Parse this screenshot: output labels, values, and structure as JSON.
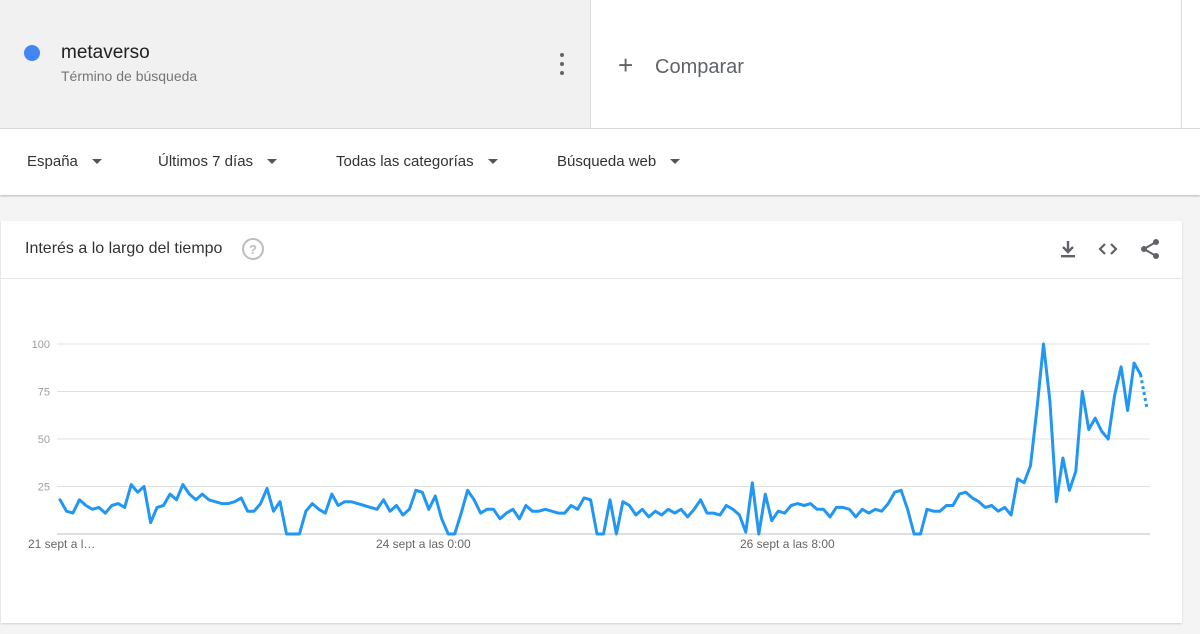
{
  "term": {
    "name": "metaverso",
    "subtitle": "Término de búsqueda",
    "color": "#4285f4"
  },
  "compare": {
    "label": "Comparar"
  },
  "filters": [
    {
      "label": "España"
    },
    {
      "label": "Últimos 7 días"
    },
    {
      "label": "Todas las categorías"
    },
    {
      "label": "Búsqueda web"
    }
  ],
  "chart_header": {
    "title": "Interés a lo largo del tiempo"
  },
  "chart_data": {
    "type": "line",
    "title": "Interés a lo largo del tiempo",
    "xlabel": "",
    "ylabel": "",
    "ylim": [
      0,
      100
    ],
    "y_ticks": [
      "25",
      "50",
      "75",
      "100"
    ],
    "x_ticks": [
      "21 sept a l…",
      "24 sept a las 0:00",
      "26 sept a las 8:00"
    ],
    "grid": true,
    "color": "#2196f3",
    "series": [
      {
        "values": [
          18,
          12,
          11,
          18,
          15,
          13,
          14,
          11,
          15,
          16,
          14,
          26,
          22,
          25,
          6,
          14,
          15,
          21,
          18,
          26,
          21,
          18,
          21,
          18,
          17,
          16,
          16,
          17,
          19,
          12,
          12,
          16,
          24,
          12,
          17,
          0,
          0,
          0,
          12,
          16,
          13,
          11,
          21,
          15,
          17,
          17,
          16,
          15,
          14,
          13,
          18,
          12,
          15,
          10,
          13,
          23,
          22,
          13,
          20,
          8,
          0,
          0,
          11,
          23,
          18,
          11,
          13,
          13,
          8,
          11,
          13,
          8,
          15,
          12,
          12,
          13,
          12,
          11,
          11,
          15,
          13,
          19,
          18,
          0,
          0,
          18,
          0,
          17,
          15,
          10,
          13,
          9,
          12,
          10,
          13,
          11,
          13,
          9,
          13,
          18,
          11,
          11,
          10,
          15,
          13,
          10,
          1,
          27,
          0,
          21,
          7,
          12,
          11,
          15,
          16,
          15,
          16,
          13,
          13,
          9,
          14,
          14,
          13,
          9,
          13,
          11,
          13,
          12,
          16,
          22,
          23,
          13,
          0,
          0,
          13,
          12,
          12,
          15,
          15,
          21,
          22,
          19,
          17,
          14,
          15,
          12,
          14,
          10,
          29,
          27,
          36,
          66,
          100,
          70,
          17,
          40,
          23,
          33,
          75,
          55,
          61,
          54,
          50,
          73,
          88,
          65,
          90,
          84,
          66
        ]
      }
    ]
  }
}
